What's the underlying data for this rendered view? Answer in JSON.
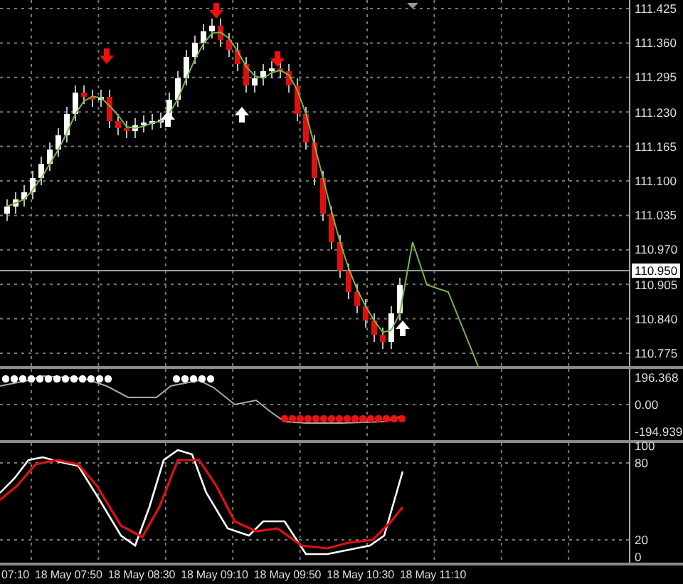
{
  "main_panel": {
    "price_axis": [
      {
        "label": "111.425",
        "kind": "tick"
      },
      {
        "label": "111.360",
        "kind": "tick"
      },
      {
        "label": "111.295",
        "kind": "tick"
      },
      {
        "label": "111.230",
        "kind": "tick"
      },
      {
        "label": "111.165",
        "kind": "tick"
      },
      {
        "label": "111.100",
        "kind": "tick"
      },
      {
        "label": "111.035",
        "kind": "tick"
      },
      {
        "label": "110.970",
        "kind": "tick"
      },
      {
        "label": "110.950",
        "kind": "current"
      },
      {
        "label": "110.905",
        "kind": "tick"
      },
      {
        "label": "110.840",
        "kind": "tick"
      },
      {
        "label": "110.775",
        "kind": "tick"
      }
    ]
  },
  "oscillator_panel": {
    "axis": [
      "196.368",
      "0.00",
      "-194.939"
    ]
  },
  "stochastic_panel": {
    "axis": [
      "100",
      "80",
      "20",
      "0"
    ]
  },
  "time_axis": [
    "07:10",
    "18 May 07:50",
    "18 May 08:30",
    "18 May 09:10",
    "18 May 09:50",
    "18 May 10:30",
    "18 May 11:10"
  ]
}
